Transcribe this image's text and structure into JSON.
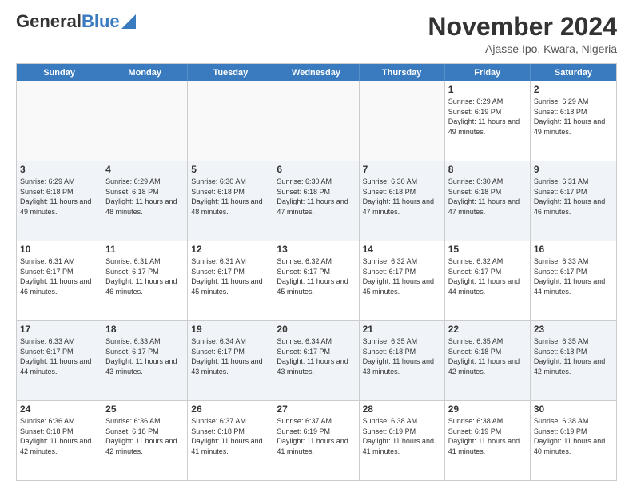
{
  "header": {
    "logo_general": "General",
    "logo_blue": "Blue",
    "title": "November 2024",
    "subtitle": "Ajasse Ipo, Kwara, Nigeria"
  },
  "calendar": {
    "days_of_week": [
      "Sunday",
      "Monday",
      "Tuesday",
      "Wednesday",
      "Thursday",
      "Friday",
      "Saturday"
    ],
    "weeks": [
      [
        {
          "day": "",
          "empty": true
        },
        {
          "day": "",
          "empty": true
        },
        {
          "day": "",
          "empty": true
        },
        {
          "day": "",
          "empty": true
        },
        {
          "day": "",
          "empty": true
        },
        {
          "day": "1",
          "sunrise": "6:29 AM",
          "sunset": "6:19 PM",
          "daylight": "11 hours and 49 minutes."
        },
        {
          "day": "2",
          "sunrise": "6:29 AM",
          "sunset": "6:18 PM",
          "daylight": "11 hours and 49 minutes."
        }
      ],
      [
        {
          "day": "3",
          "sunrise": "6:29 AM",
          "sunset": "6:18 PM",
          "daylight": "11 hours and 49 minutes."
        },
        {
          "day": "4",
          "sunrise": "6:29 AM",
          "sunset": "6:18 PM",
          "daylight": "11 hours and 48 minutes."
        },
        {
          "day": "5",
          "sunrise": "6:30 AM",
          "sunset": "6:18 PM",
          "daylight": "11 hours and 48 minutes."
        },
        {
          "day": "6",
          "sunrise": "6:30 AM",
          "sunset": "6:18 PM",
          "daylight": "11 hours and 47 minutes."
        },
        {
          "day": "7",
          "sunrise": "6:30 AM",
          "sunset": "6:18 PM",
          "daylight": "11 hours and 47 minutes."
        },
        {
          "day": "8",
          "sunrise": "6:30 AM",
          "sunset": "6:18 PM",
          "daylight": "11 hours and 47 minutes."
        },
        {
          "day": "9",
          "sunrise": "6:31 AM",
          "sunset": "6:17 PM",
          "daylight": "11 hours and 46 minutes."
        }
      ],
      [
        {
          "day": "10",
          "sunrise": "6:31 AM",
          "sunset": "6:17 PM",
          "daylight": "11 hours and 46 minutes."
        },
        {
          "day": "11",
          "sunrise": "6:31 AM",
          "sunset": "6:17 PM",
          "daylight": "11 hours and 46 minutes."
        },
        {
          "day": "12",
          "sunrise": "6:31 AM",
          "sunset": "6:17 PM",
          "daylight": "11 hours and 45 minutes."
        },
        {
          "day": "13",
          "sunrise": "6:32 AM",
          "sunset": "6:17 PM",
          "daylight": "11 hours and 45 minutes."
        },
        {
          "day": "14",
          "sunrise": "6:32 AM",
          "sunset": "6:17 PM",
          "daylight": "11 hours and 45 minutes."
        },
        {
          "day": "15",
          "sunrise": "6:32 AM",
          "sunset": "6:17 PM",
          "daylight": "11 hours and 44 minutes."
        },
        {
          "day": "16",
          "sunrise": "6:33 AM",
          "sunset": "6:17 PM",
          "daylight": "11 hours and 44 minutes."
        }
      ],
      [
        {
          "day": "17",
          "sunrise": "6:33 AM",
          "sunset": "6:17 PM",
          "daylight": "11 hours and 44 minutes."
        },
        {
          "day": "18",
          "sunrise": "6:33 AM",
          "sunset": "6:17 PM",
          "daylight": "11 hours and 43 minutes."
        },
        {
          "day": "19",
          "sunrise": "6:34 AM",
          "sunset": "6:17 PM",
          "daylight": "11 hours and 43 minutes."
        },
        {
          "day": "20",
          "sunrise": "6:34 AM",
          "sunset": "6:17 PM",
          "daylight": "11 hours and 43 minutes."
        },
        {
          "day": "21",
          "sunrise": "6:35 AM",
          "sunset": "6:18 PM",
          "daylight": "11 hours and 43 minutes."
        },
        {
          "day": "22",
          "sunrise": "6:35 AM",
          "sunset": "6:18 PM",
          "daylight": "11 hours and 42 minutes."
        },
        {
          "day": "23",
          "sunrise": "6:35 AM",
          "sunset": "6:18 PM",
          "daylight": "11 hours and 42 minutes."
        }
      ],
      [
        {
          "day": "24",
          "sunrise": "6:36 AM",
          "sunset": "6:18 PM",
          "daylight": "11 hours and 42 minutes."
        },
        {
          "day": "25",
          "sunrise": "6:36 AM",
          "sunset": "6:18 PM",
          "daylight": "11 hours and 42 minutes."
        },
        {
          "day": "26",
          "sunrise": "6:37 AM",
          "sunset": "6:18 PM",
          "daylight": "11 hours and 41 minutes."
        },
        {
          "day": "27",
          "sunrise": "6:37 AM",
          "sunset": "6:19 PM",
          "daylight": "11 hours and 41 minutes."
        },
        {
          "day": "28",
          "sunrise": "6:38 AM",
          "sunset": "6:19 PM",
          "daylight": "11 hours and 41 minutes."
        },
        {
          "day": "29",
          "sunrise": "6:38 AM",
          "sunset": "6:19 PM",
          "daylight": "11 hours and 41 minutes."
        },
        {
          "day": "30",
          "sunrise": "6:38 AM",
          "sunset": "6:19 PM",
          "daylight": "11 hours and 40 minutes."
        }
      ]
    ]
  }
}
